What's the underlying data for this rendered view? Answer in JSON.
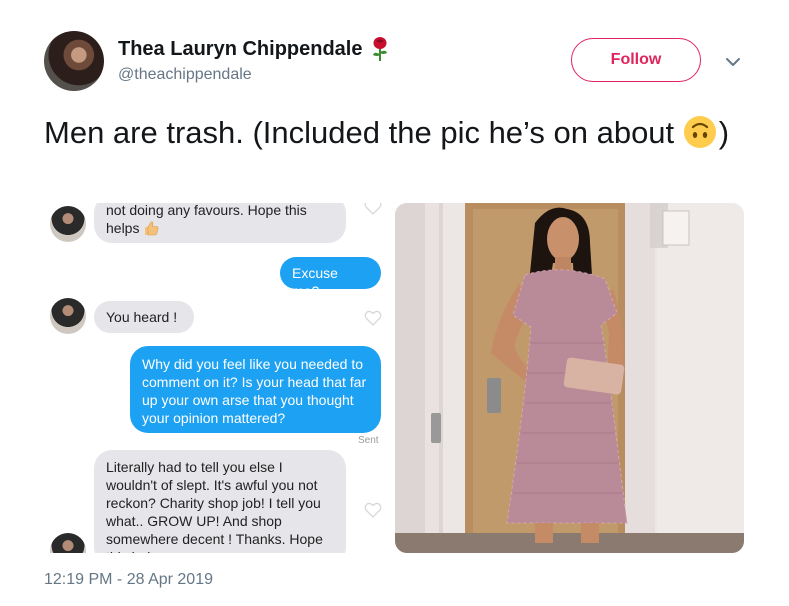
{
  "tweet": {
    "display_name": "Thea Lauryn Chippendale",
    "name_emoji_icon": "rose-icon",
    "handle": "@theachippendale",
    "follow_label": "Follow",
    "text_before_emoji": "Men are trash. (Included the pic he’s on about ",
    "inline_emoji_icon": "upside-down-face-icon",
    "text_after_emoji": ")",
    "timestamp": "12:19 PM - 28 Apr 2019",
    "accent_color": "#e0245e"
  },
  "dm_screenshot": {
    "messages": [
      {
        "from": "them",
        "text": "not doing any favours. Hope this helps",
        "emoji_icon": "thumbs-up-icon"
      },
      {
        "from": "me",
        "text": "Excuse me?"
      },
      {
        "from": "them",
        "text": "You heard !"
      },
      {
        "from": "me",
        "text": "Why did you feel like you needed to comment on it? Is your head that far up your own arse that you thought your opinion mattered?"
      },
      {
        "from": "them",
        "text": "Literally had to tell you else I wouldn't of slept. It's awful you not reckon? Charity shop job! I tell you what.. GROW UP! And shop somewhere decent ! Thanks. Hope this helps"
      }
    ],
    "sent_label": "Sent",
    "bubble_color_me": "#1da1f2",
    "bubble_color_them": "#e5e5ea"
  },
  "photo": {
    "subject_icon": "woman-in-pink-lace-dress"
  }
}
